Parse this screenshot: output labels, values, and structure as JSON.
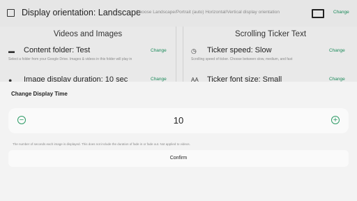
{
  "topbar": {
    "title": "Display orientation: Landscape",
    "description": "Choose Landscape/Portrait (auto) Horizontal/Vertical display orientation",
    "change_label": "Change"
  },
  "videos_panel": {
    "heading": "Videos and Images",
    "content_folder": {
      "title": "Content folder: Test",
      "description": "Select a folder from your Google Drive. Images & videos in this folder will play in",
      "change_label": "Change"
    },
    "image_duration": {
      "title": "Image display duration: 10 sec",
      "change_label": "Change"
    }
  },
  "ticker_panel": {
    "heading": "Scrolling Ticker Text",
    "speed": {
      "title": "Ticker speed: Slow",
      "description": "Scrolling speed of ticker. Choose between slow, medium, and fast",
      "change_label": "Change"
    },
    "font_size": {
      "title": "Ticker font size: Small",
      "change_label": "Change"
    }
  },
  "dialog": {
    "title": "Change Display Time",
    "value": "10",
    "note": "The number of seconds each image is displayed. This does not include the duration of fade in or fade out. Not applied to videos.",
    "confirm_label": "Confirm"
  },
  "colors": {
    "accent": "#2e9b66",
    "sheet_bg": "#f3f3f3",
    "backdrop": "#e9e9e9"
  }
}
